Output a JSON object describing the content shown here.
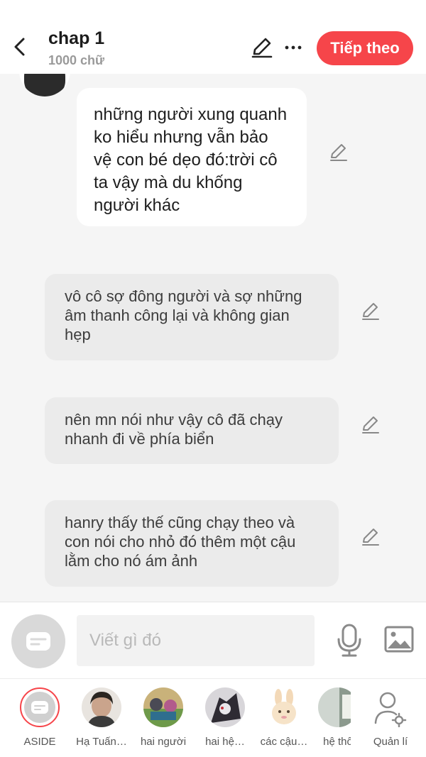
{
  "header": {
    "title": "chap 1",
    "subtitle": "1000 chữ",
    "next_label": "Tiếp theo"
  },
  "messages": [
    {
      "style": "white",
      "text": "những người xung quanh ko hiểu nhưng vẫn bảo vệ con bé dẹo đó:trời cô ta vậy mà du khống người khác"
    },
    {
      "style": "gray",
      "text": "vô cô sợ đông người và sợ những âm thanh công lại và không gian hẹp"
    },
    {
      "style": "gray",
      "text": "nên mn nói như vậy cô đã chạy nhanh đi về phía biển"
    },
    {
      "style": "gray",
      "text": "hanry thấy thế cũng chạy theo và con nói cho nhỏ đó thêm một cậu lằm cho nó ám ảnh"
    }
  ],
  "input": {
    "placeholder": "Viết gì đó"
  },
  "characters": [
    {
      "name": "ASIDE"
    },
    {
      "name": "Hạ Tuấn…"
    },
    {
      "name": "hai người"
    },
    {
      "name": "hai hệ…"
    },
    {
      "name": "các cậu…"
    },
    {
      "name": "hệ thố"
    }
  ],
  "manage_label": "Quản lí",
  "colors": {
    "accent": "#f6454a",
    "background": "#f5f5f5",
    "bubble_gray": "#ebebeb"
  }
}
